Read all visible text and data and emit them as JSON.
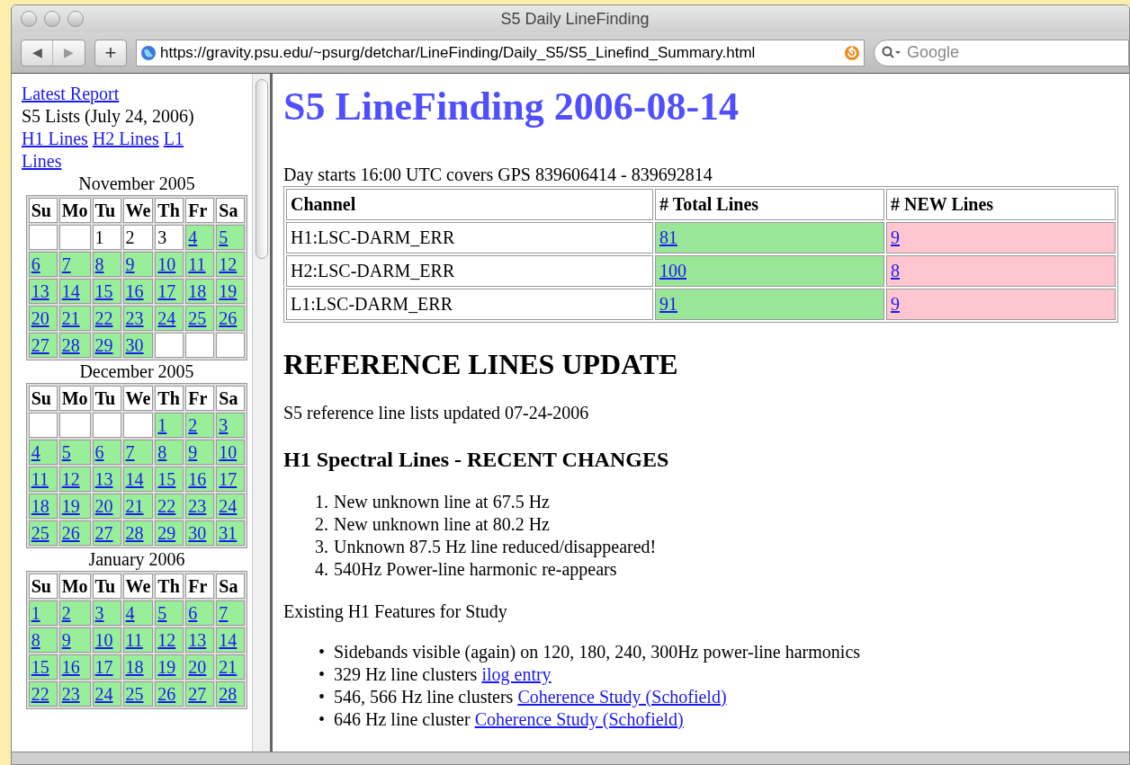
{
  "window": {
    "title": "S5 Daily LineFinding"
  },
  "toolbar": {
    "back": "◀",
    "forward": "▶",
    "add": "+",
    "url": "https://gravity.psu.edu/~psurg/detchar/LineFinding/Daily_S5/S5_Linefind_Summary.html",
    "search_placeholder": "Google"
  },
  "sidebar": {
    "latest_link": "Latest Report",
    "lists_label": "S5 Lists (July 24, 2006)",
    "list_links": [
      {
        "lines": [
          "H1 Lines"
        ]
      },
      {
        "lines": [
          "H2 Lines"
        ]
      },
      {
        "lines": [
          "L1",
          "Lines"
        ]
      }
    ],
    "calendars": [
      {
        "title": "November 2005",
        "days": [
          "Su",
          "Mo",
          "Tu",
          "We",
          "Th",
          "Fr",
          "Sa"
        ],
        "weeks": [
          [
            {
              "linked": false
            },
            {
              "linked": false
            },
            {
              "day": "1",
              "linked": false
            },
            {
              "day": "2",
              "linked": false
            },
            {
              "day": "3",
              "linked": false
            },
            {
              "day": "4",
              "linked": true
            },
            {
              "day": "5",
              "linked": true
            }
          ],
          [
            {
              "day": "6",
              "linked": true
            },
            {
              "day": "7",
              "linked": true
            },
            {
              "day": "8",
              "linked": true
            },
            {
              "day": "9",
              "linked": true
            },
            {
              "day": "10",
              "linked": true
            },
            {
              "day": "11",
              "linked": true
            },
            {
              "day": "12",
              "linked": true
            }
          ],
          [
            {
              "day": "13",
              "linked": true
            },
            {
              "day": "14",
              "linked": true
            },
            {
              "day": "15",
              "linked": true
            },
            {
              "day": "16",
              "linked": true
            },
            {
              "day": "17",
              "linked": true
            },
            {
              "day": "18",
              "linked": true
            },
            {
              "day": "19",
              "linked": true
            }
          ],
          [
            {
              "day": "20",
              "linked": true
            },
            {
              "day": "21",
              "linked": true
            },
            {
              "day": "22",
              "linked": true
            },
            {
              "day": "23",
              "linked": true
            },
            {
              "day": "24",
              "linked": true
            },
            {
              "day": "25",
              "linked": true
            },
            {
              "day": "26",
              "linked": true
            }
          ],
          [
            {
              "day": "27",
              "linked": true
            },
            {
              "day": "28",
              "linked": true
            },
            {
              "day": "29",
              "linked": true
            },
            {
              "day": "30",
              "linked": true
            },
            {
              "linked": false
            },
            {
              "linked": false
            },
            {
              "linked": false
            }
          ]
        ]
      },
      {
        "title": "December 2005",
        "days": [
          "Su",
          "Mo",
          "Tu",
          "We",
          "Th",
          "Fr",
          "Sa"
        ],
        "weeks": [
          [
            {
              "linked": false
            },
            {
              "linked": false
            },
            {
              "linked": false
            },
            {
              "linked": false
            },
            {
              "day": "1",
              "linked": true
            },
            {
              "day": "2",
              "linked": true
            },
            {
              "day": "3",
              "linked": true
            }
          ],
          [
            {
              "day": "4",
              "linked": true
            },
            {
              "day": "5",
              "linked": true
            },
            {
              "day": "6",
              "linked": true
            },
            {
              "day": "7",
              "linked": true
            },
            {
              "day": "8",
              "linked": true
            },
            {
              "day": "9",
              "linked": true
            },
            {
              "day": "10",
              "linked": true
            }
          ],
          [
            {
              "day": "11",
              "linked": true
            },
            {
              "day": "12",
              "linked": true
            },
            {
              "day": "13",
              "linked": true
            },
            {
              "day": "14",
              "linked": true
            },
            {
              "day": "15",
              "linked": true
            },
            {
              "day": "16",
              "linked": true
            },
            {
              "day": "17",
              "linked": true
            }
          ],
          [
            {
              "day": "18",
              "linked": true
            },
            {
              "day": "19",
              "linked": true
            },
            {
              "day": "20",
              "linked": true
            },
            {
              "day": "21",
              "linked": true
            },
            {
              "day": "22",
              "linked": true
            },
            {
              "day": "23",
              "linked": true
            },
            {
              "day": "24",
              "linked": true
            }
          ],
          [
            {
              "day": "25",
              "linked": true
            },
            {
              "day": "26",
              "linked": true
            },
            {
              "day": "27",
              "linked": true
            },
            {
              "day": "28",
              "linked": true
            },
            {
              "day": "29",
              "linked": true
            },
            {
              "day": "30",
              "linked": true
            },
            {
              "day": "31",
              "linked": true
            }
          ]
        ]
      },
      {
        "title": "January 2006",
        "days": [
          "Su",
          "Mo",
          "Tu",
          "We",
          "Th",
          "Fr",
          "Sa"
        ],
        "weeks": [
          [
            {
              "day": "1",
              "linked": true
            },
            {
              "day": "2",
              "linked": true
            },
            {
              "day": "3",
              "linked": true
            },
            {
              "day": "4",
              "linked": true
            },
            {
              "day": "5",
              "linked": true
            },
            {
              "day": "6",
              "linked": true
            },
            {
              "day": "7",
              "linked": true
            }
          ],
          [
            {
              "day": "8",
              "linked": true
            },
            {
              "day": "9",
              "linked": true
            },
            {
              "day": "10",
              "linked": true
            },
            {
              "day": "11",
              "linked": true
            },
            {
              "day": "12",
              "linked": true
            },
            {
              "day": "13",
              "linked": true
            },
            {
              "day": "14",
              "linked": true
            }
          ],
          [
            {
              "day": "15",
              "linked": true
            },
            {
              "day": "16",
              "linked": true
            },
            {
              "day": "17",
              "linked": true
            },
            {
              "day": "18",
              "linked": true
            },
            {
              "day": "19",
              "linked": true
            },
            {
              "day": "20",
              "linked": true
            },
            {
              "day": "21",
              "linked": true
            }
          ],
          [
            {
              "day": "22",
              "linked": true
            },
            {
              "day": "23",
              "linked": true
            },
            {
              "day": "24",
              "linked": true
            },
            {
              "day": "25",
              "linked": true
            },
            {
              "day": "26",
              "linked": true
            },
            {
              "day": "27",
              "linked": true
            },
            {
              "day": "28",
              "linked": true
            }
          ]
        ]
      }
    ]
  },
  "main": {
    "title": "S5 LineFinding 2006-08-14",
    "day_info": "Day starts 16:00 UTC covers GPS 839606414 - 839692814",
    "table": {
      "columns": [
        "Channel",
        "# Total Lines",
        "# NEW Lines"
      ],
      "rows": [
        {
          "channel": "H1:LSC-DARM_ERR",
          "total": "81",
          "new": "9"
        },
        {
          "channel": "H2:LSC-DARM_ERR",
          "total": "100",
          "new": "8"
        },
        {
          "channel": "L1:LSC-DARM_ERR",
          "total": "91",
          "new": "9"
        }
      ]
    },
    "reference_heading": "REFERENCE LINES UPDATE",
    "reference_note": "S5 reference line lists updated 07-24-2006",
    "changes_heading": "H1 Spectral Lines - RECENT CHANGES",
    "changes": [
      {
        "number": "1.",
        "text": "New unknown line at 67.5 Hz"
      },
      {
        "number": "2.",
        "text": "New unknown line at 80.2 Hz"
      },
      {
        "number": "3.",
        "text": "Unknown 87.5 Hz line reduced/disappeared!"
      },
      {
        "number": "4.",
        "text": "540Hz Power-line harmonic re-appears"
      }
    ],
    "features_label": "Existing H1 Features for Study",
    "features": [
      {
        "bullet": "•",
        "text": "Sidebands visible (again) on 120, 180, 240, 300Hz power-line harmonics"
      },
      {
        "bullet": "•",
        "text": "329 Hz line clusters",
        "link": "ilog entry"
      },
      {
        "bullet": "•",
        "text": "546, 566 Hz line clusters",
        "link": "Coherence Study (Schofield)"
      },
      {
        "bullet": "•",
        "text": "646 Hz line cluster",
        "link": "Coherence Study (Schofield)"
      }
    ]
  }
}
